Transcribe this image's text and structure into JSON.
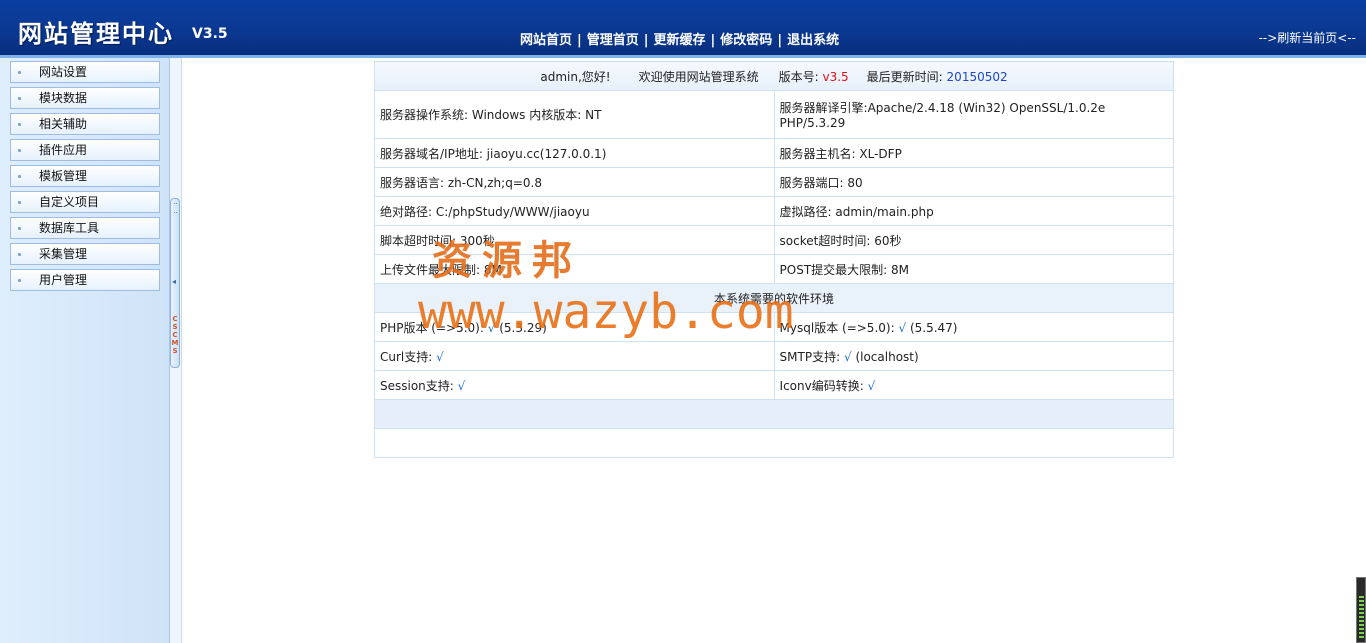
{
  "header": {
    "title": "网站管理中心",
    "version": "V3.5",
    "nav": [
      "网站首页",
      "管理首页",
      "更新缓存",
      "修改密码",
      "退出系统"
    ],
    "separator": "|",
    "refresh": "-->刷新当前页<--"
  },
  "sidebar": {
    "items": [
      {
        "label": "网站设置"
      },
      {
        "label": "模块数据"
      },
      {
        "label": "相关辅助"
      },
      {
        "label": "插件应用"
      },
      {
        "label": "模板管理"
      },
      {
        "label": "自定义项目"
      },
      {
        "label": "数据库工具"
      },
      {
        "label": "采集管理"
      },
      {
        "label": "用户管理"
      }
    ],
    "splitter_label": "CSCMS",
    "splitter_arrow": "◂"
  },
  "welcome": {
    "greeting": "admin,您好!",
    "message": "欢迎使用网站管理系统",
    "version_label": "版本号:",
    "version_value": "v3.5",
    "update_label": "最后更新时间:",
    "update_value": "20150502"
  },
  "server": {
    "os": "服务器操作系统: Windows 内核版本: NT",
    "engine": "服务器解译引擎:Apache/2.4.18 (Win32) OpenSSL/1.0.2e PHP/5.3.29",
    "domain": "服务器域名/IP地址: jiaoyu.cc(127.0.0.1)",
    "hostname": "服务器主机名: XL-DFP",
    "language": "服务器语言: zh-CN,zh;q=0.8",
    "port": "服务器端口: 80",
    "abs_path": "绝对路径: C:/phpStudy/WWW/jiaoyu",
    "virtual_path": "虚拟路径: admin/main.php",
    "script_timeout": "脚本超时时间: 300秒",
    "socket_timeout": "socket超时时间: 60秒",
    "upload_limit": "上传文件最大限制: 8M",
    "post_limit": "POST提交最大限制: 8M"
  },
  "requirements": {
    "title": "本系统需要的软件环境",
    "php_label": "PHP版本 (=>5.0):",
    "php_value": "(5.3.29)",
    "mysql_label": "Mysql版本 (=>5.0):",
    "mysql_value": "(5.5.47)",
    "curl_label": "Curl支持:",
    "smtp_label": "SMTP支持:",
    "smtp_value": "(localhost)",
    "session_label": "Session支持:",
    "iconv_label": "Iconv编码转换:",
    "check": "√"
  },
  "watermark": {
    "line1": "资源邦",
    "line2": "www.wazyb.com"
  },
  "colors": {
    "header_bg": "#0b3a95",
    "version_red": "#e0101a",
    "date_blue": "#1f47c9",
    "check_blue": "#1e6fd0"
  }
}
